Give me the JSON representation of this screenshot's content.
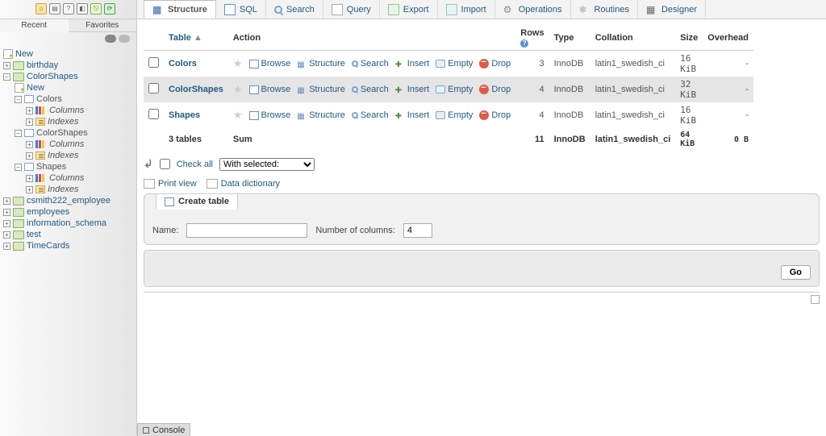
{
  "sidebar": {
    "tabs": {
      "recent": "Recent",
      "favorites": "Favorites"
    },
    "new_label": "New",
    "databases": [
      {
        "name": "birthday",
        "expanded": false
      },
      {
        "name": "ColorShapes",
        "expanded": true,
        "children": [
          {
            "type": "new",
            "label": "New"
          },
          {
            "type": "table",
            "name": "Colors",
            "expanded": true,
            "cols": "Columns",
            "idx": "Indexes"
          },
          {
            "type": "table",
            "name": "ColorShapes",
            "expanded": true,
            "cols": "Columns",
            "idx": "Indexes"
          },
          {
            "type": "table",
            "name": "Shapes",
            "expanded": true,
            "cols": "Columns",
            "idx": "Indexes"
          }
        ]
      },
      {
        "name": "csmith222_employee",
        "expanded": false
      },
      {
        "name": "employees",
        "expanded": false
      },
      {
        "name": "information_schema",
        "expanded": false
      },
      {
        "name": "test",
        "expanded": false
      },
      {
        "name": "TimeCards",
        "expanded": false
      }
    ]
  },
  "topnav": [
    {
      "key": "structure",
      "label": "Structure"
    },
    {
      "key": "sql",
      "label": "SQL"
    },
    {
      "key": "search",
      "label": "Search"
    },
    {
      "key": "query",
      "label": "Query"
    },
    {
      "key": "export",
      "label": "Export"
    },
    {
      "key": "import",
      "label": "Import"
    },
    {
      "key": "operations",
      "label": "Operations"
    },
    {
      "key": "routines",
      "label": "Routines"
    },
    {
      "key": "designer",
      "label": "Designer"
    }
  ],
  "table": {
    "headers": {
      "table": "Table",
      "action": "Action",
      "rows": "Rows",
      "type": "Type",
      "collation": "Collation",
      "size": "Size",
      "overhead": "Overhead"
    },
    "actions": {
      "browse": "Browse",
      "structure": "Structure",
      "search": "Search",
      "insert": "Insert",
      "empty": "Empty",
      "drop": "Drop"
    },
    "rows": [
      {
        "name": "Colors",
        "rows": "3",
        "type": "InnoDB",
        "collation": "latin1_swedish_ci",
        "size": "16 KiB",
        "overhead": "-"
      },
      {
        "name": "ColorShapes",
        "rows": "4",
        "type": "InnoDB",
        "collation": "latin1_swedish_ci",
        "size": "32 KiB",
        "overhead": "-"
      },
      {
        "name": "Shapes",
        "rows": "4",
        "type": "InnoDB",
        "collation": "latin1_swedish_ci",
        "size": "16 KiB",
        "overhead": "-"
      }
    ],
    "summary": {
      "count": "3 tables",
      "sum": "Sum",
      "rows": "11",
      "type": "InnoDB",
      "collation": "latin1_swedish_ci",
      "size": "64 KiB",
      "overhead": "0 B"
    }
  },
  "checkall": {
    "label": "Check all",
    "selected": "With selected:"
  },
  "links": {
    "print": "Print view",
    "dict": "Data dictionary"
  },
  "create": {
    "legend": "Create table",
    "name_label": "Name:",
    "cols_label": "Number of columns:",
    "cols_value": "4"
  },
  "go": "Go",
  "console": "Console"
}
